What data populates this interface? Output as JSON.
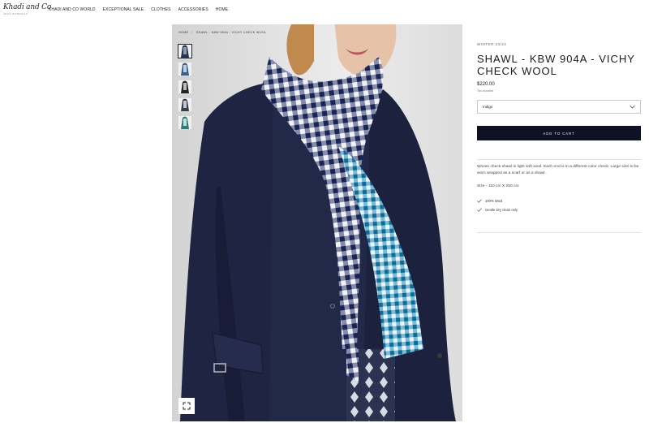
{
  "header": {
    "logo_text": "Khadi and Co",
    "logo_sub": "JEAN BORDEAU",
    "nav": [
      "KHADI AND CO WORLD",
      "EXCEPTIONAL SALE",
      "CLOTHES",
      "ACCESSORIES",
      "HOME"
    ]
  },
  "breadcrumb": {
    "home": "HOME",
    "separator": "/",
    "current": "SHAWL - KBW 904A - VICHY CHECK WOOL"
  },
  "thumbnails": [
    {
      "name": "thumbnail-1",
      "colors": [
        "#2a3551",
        "#8a9bb3"
      ]
    },
    {
      "name": "thumbnail-2",
      "colors": [
        "#3b5f8a",
        "#bcd0e0"
      ]
    },
    {
      "name": "thumbnail-3",
      "colors": [
        "#222222",
        "#bbbbbb"
      ]
    },
    {
      "name": "thumbnail-4",
      "colors": [
        "#3a3f4c",
        "#c2c7d2"
      ]
    },
    {
      "name": "thumbnail-5",
      "colors": [
        "#2f7b78",
        "#bfe0dc"
      ]
    }
  ],
  "product": {
    "season": "WINTER 23/24",
    "title": "SHAWL - KBW 904A - VICHY CHECK WOOL",
    "price": "$220.00",
    "tax_note": "Tax included",
    "variant_selected": "Indigo",
    "add_to_cart": "ADD TO CART",
    "description": "Woven check shawl in light soft wool. Each end  is in a different color check. Large size to be worn wrapped as a scarf or as a shawl.",
    "size": "Size - 110 cm X 250 cm",
    "features": [
      "100% Wool",
      "Gentle Dry clean only"
    ]
  },
  "colors": {
    "button_bg": "#0f1124",
    "coat": "#1e2340",
    "check_dark": "#1f2c55",
    "check_teal": "#1779a6"
  },
  "icons": {
    "select": "chevron-down-icon",
    "zoom": "expand-icon",
    "feature": "check-icon"
  }
}
